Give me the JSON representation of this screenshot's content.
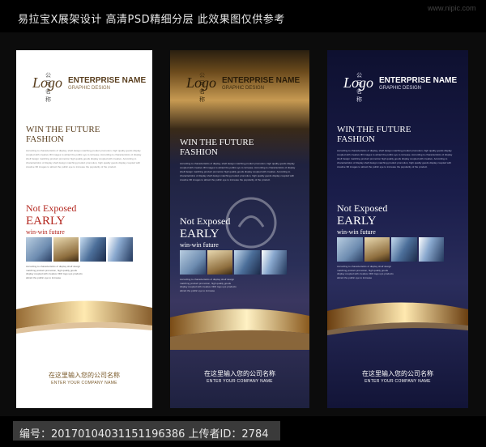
{
  "header": {
    "title": "易拉宝X展架设计 高清PSD精细分层 此效果图仅供参考",
    "watermark": "www.nipic.com"
  },
  "banner": {
    "logo_small": "公司名称",
    "logo_word": "Logo",
    "enterprise_name": "ENTERPRISE NAME",
    "graphic_design": "GRAPHIC DESIGN",
    "win_line1": "WIN THE FUTURE",
    "win_line2": "FASHION",
    "body_text": "According to characteristics of display, shelf design matching product promotion, high quality goods display coupled with creative 3D images to attract the public eye to increase. According to characteristics of display shelf design matching product promotion high quality goods display coupled with creative. According to characteristics of display shelf design matching product promotion, high quality goods display coupled with creative 3D images to attract the public eye to increase the popularity of the product.",
    "not_exposed": "Not Exposed",
    "early": "EARLY",
    "winwin": "win-win future",
    "small_desc": "According to characteristics of display shelf design matching product promotion, high quality goods display coupled with creative 3DO logo ups products attract the public eye to increase",
    "company_cn": "在这里输入您的公司名称",
    "company_en": "ENTER YOUR COMPANY NAME"
  },
  "footer": {
    "text": "编号：20170104031151196386 上传者ID：2784"
  },
  "colors": {
    "red": "#b3261e",
    "gold": "#d9a441",
    "navy": "#1a1d4a",
    "text_light": "#ffffff",
    "text_dark": "#7a5a2a"
  }
}
